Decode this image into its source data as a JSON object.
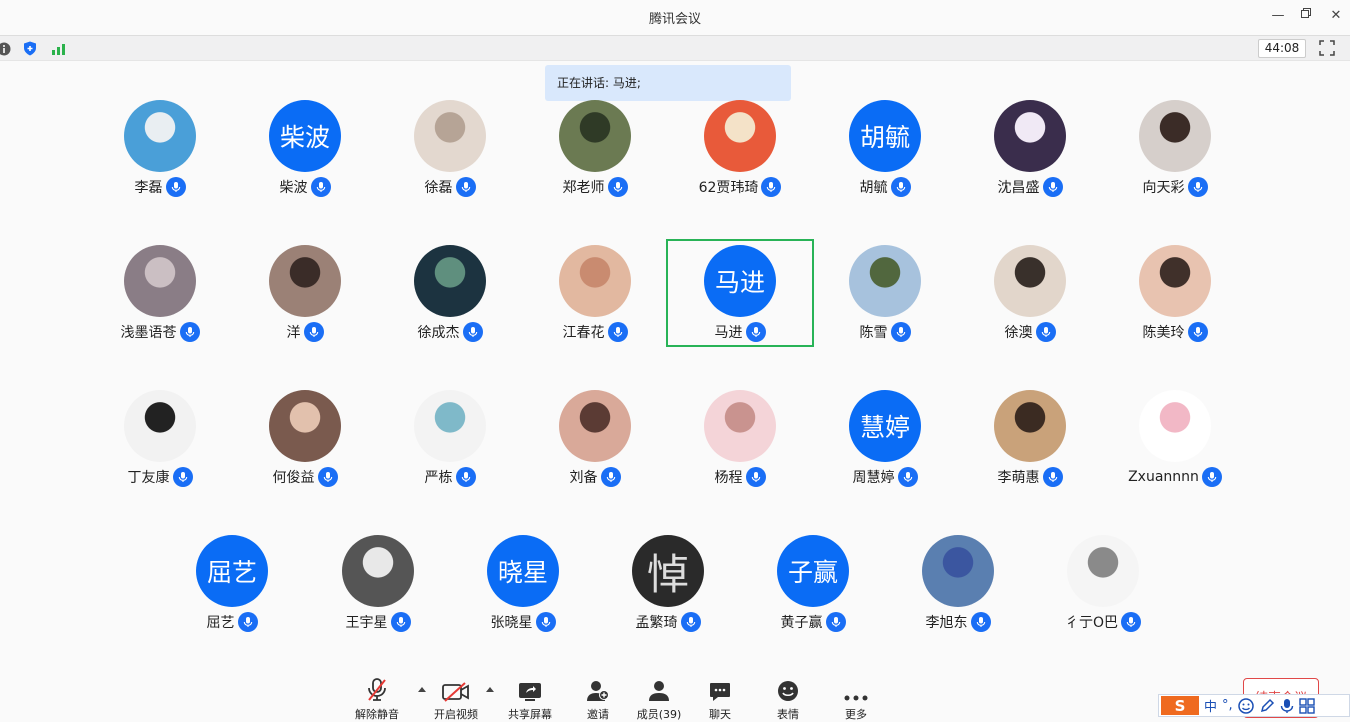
{
  "window": {
    "title": "腾讯会议",
    "minimize_label": "—",
    "maximize_label": "▫",
    "close_label": "✕"
  },
  "status": {
    "timer": "44:08"
  },
  "speaking_banner": "正在讲话: 马进;",
  "participants": [
    {
      "name": "李磊",
      "avatar": {
        "type": "image",
        "bg": "#4a9fd8",
        "accent": "#e9eef2"
      }
    },
    {
      "name": "柴波",
      "avatar": {
        "type": "text",
        "text": "柴波"
      }
    },
    {
      "name": "徐磊",
      "avatar": {
        "type": "image",
        "bg": "#e3d8cf",
        "accent": "#b6a496"
      }
    },
    {
      "name": "郑老师",
      "avatar": {
        "type": "image",
        "bg": "#6b7a52",
        "accent": "#2f3a26"
      }
    },
    {
      "name": "62贾玮琦",
      "avatar": {
        "type": "image",
        "bg": "#e85a3a",
        "accent": "#f4e2c8"
      }
    },
    {
      "name": "胡毓",
      "avatar": {
        "type": "text",
        "text": "胡毓"
      }
    },
    {
      "name": "沈昌盛",
      "avatar": {
        "type": "image",
        "bg": "#3a2d4c",
        "accent": "#f0e9f5"
      }
    },
    {
      "name": "向天彩",
      "avatar": {
        "type": "image",
        "bg": "#d6cfcb",
        "accent": "#3b2c27"
      }
    },
    {
      "name": "浅墨语苍",
      "avatar": {
        "type": "image",
        "bg": "#8a7d86",
        "accent": "#cbbfc3"
      }
    },
    {
      "name": "洋",
      "avatar": {
        "type": "image",
        "bg": "#9b8176",
        "accent": "#3a2c28"
      }
    },
    {
      "name": "徐成杰",
      "avatar": {
        "type": "image",
        "bg": "#1c3340",
        "accent": "#5f8f7e"
      }
    },
    {
      "name": "江春花",
      "avatar": {
        "type": "image",
        "bg": "#e2b8a0",
        "accent": "#c98b70"
      }
    },
    {
      "name": "马进",
      "avatar": {
        "type": "text",
        "text": "马进"
      },
      "active": true
    },
    {
      "name": "陈雪",
      "avatar": {
        "type": "image",
        "bg": "#a7c2dd",
        "accent": "#51673e"
      }
    },
    {
      "name": "徐澳",
      "avatar": {
        "type": "image",
        "bg": "#e2d6cb",
        "accent": "#39302b"
      }
    },
    {
      "name": "陈美玲",
      "avatar": {
        "type": "image",
        "bg": "#e8c3b0",
        "accent": "#40302a"
      }
    },
    {
      "name": "丁友康",
      "avatar": {
        "type": "image",
        "bg": "#f2f2f2",
        "accent": "#222222"
      }
    },
    {
      "name": "何俊益",
      "avatar": {
        "type": "image",
        "bg": "#7a5a4e",
        "accent": "#e2c1ad"
      }
    },
    {
      "name": "严栋",
      "avatar": {
        "type": "image",
        "bg": "#f3f3f3",
        "accent": "#7fb9c9"
      }
    },
    {
      "name": "刘备",
      "avatar": {
        "type": "image",
        "bg": "#d9a999",
        "accent": "#5b3b34"
      }
    },
    {
      "name": "杨程",
      "avatar": {
        "type": "image",
        "bg": "#f4d4d8",
        "accent": "#c9938f"
      }
    },
    {
      "name": "周慧婷",
      "avatar": {
        "type": "text",
        "text": "慧婷"
      }
    },
    {
      "name": "李萌惠",
      "avatar": {
        "type": "image",
        "bg": "#c9a27a",
        "accent": "#3b2b22"
      }
    },
    {
      "name": "Zxuannnn",
      "avatar": {
        "type": "image",
        "bg": "#ffffff",
        "accent": "#f2b8c6"
      }
    },
    {
      "name": "屈艺",
      "avatar": {
        "type": "text",
        "text": "屈艺"
      }
    },
    {
      "name": "王宇星",
      "avatar": {
        "type": "image",
        "bg": "#555555",
        "accent": "#e8e8e8"
      }
    },
    {
      "name": "张晓星",
      "avatar": {
        "type": "text",
        "text": "晓星"
      }
    },
    {
      "name": "孟繁琦",
      "avatar": {
        "type": "image",
        "bg": "#2a2a2a",
        "accent": "#dcdcdc",
        "glyph": "悼"
      }
    },
    {
      "name": "黄子赢",
      "avatar": {
        "type": "text",
        "text": "子赢"
      }
    },
    {
      "name": "李旭东",
      "avatar": {
        "type": "image",
        "bg": "#5a7fb0",
        "accent": "#3b56a0"
      }
    },
    {
      "name": "彳亍O巴",
      "avatar": {
        "type": "image",
        "bg": "#f5f5f5",
        "accent": "#8a8a8a"
      }
    }
  ],
  "toolbar": {
    "unmute": "解除静音",
    "video": "开启视频",
    "share": "共享屏幕",
    "invite": "邀请",
    "members": "成员(39)",
    "chat": "聊天",
    "reactions": "表情",
    "more": "更多",
    "end": "结束会议"
  },
  "ime": {
    "lang": "中",
    "punct": "°,"
  },
  "colors": {
    "accent_blue": "#0a6cf5",
    "active_border": "#28b357",
    "banner_bg": "#d9e8fc",
    "end_red": "#e04848"
  }
}
